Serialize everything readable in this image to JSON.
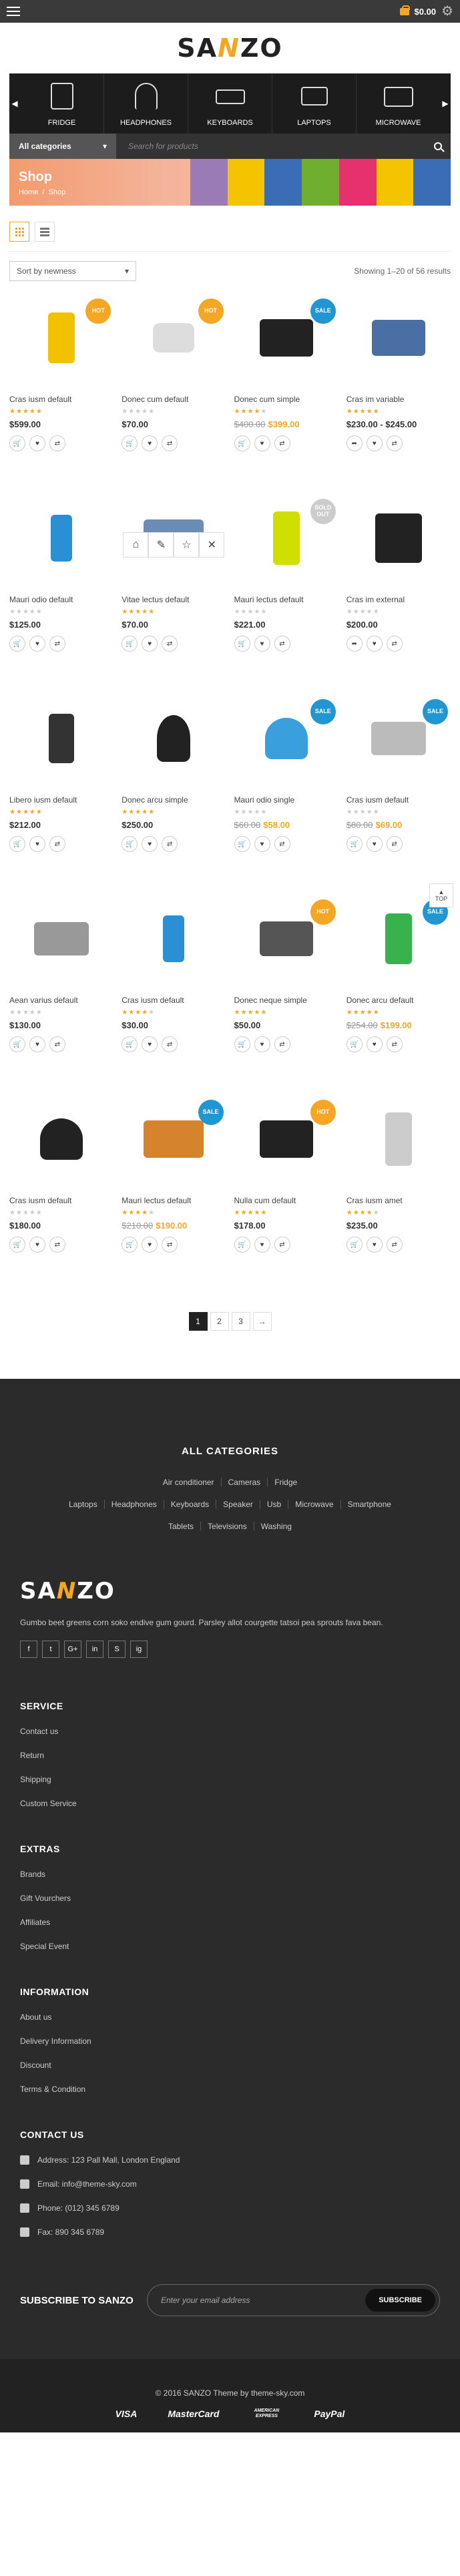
{
  "topbar": {
    "cart_total": "$0.00"
  },
  "logo": {
    "left": "SA",
    "mid": "N",
    "right": "ZO"
  },
  "categories_slider": [
    {
      "label": "FRIDGE",
      "icon": "fridge-icon"
    },
    {
      "label": "HEADPHONES",
      "icon": "headphones-icon"
    },
    {
      "label": "KEYBOARDS",
      "icon": "keyboard-icon"
    },
    {
      "label": "LAPTOPS",
      "icon": "laptop-icon"
    },
    {
      "label": "MICROWAVE",
      "icon": "microwave-icon"
    }
  ],
  "search": {
    "category": "All categories",
    "placeholder": "Search for products"
  },
  "banner": {
    "title": "Shop",
    "crumb_home": "Home",
    "crumb_sep": "/",
    "crumb_current": "Shop",
    "stripes": [
      "#9a7bb5",
      "#f5c400",
      "#3a6db5",
      "#6fae2e",
      "#e6316e",
      "#f5c400",
      "#3a6db5"
    ]
  },
  "toolbar": {
    "sort": "Sort by newness",
    "result_count": "Showing 1–20 of 56 results"
  },
  "colors": {
    "accent": "#f5a623",
    "sale": "#2196d3",
    "dark": "#2b2b2b"
  },
  "products": [
    {
      "name": "Cras iusm default",
      "rating": 5,
      "price": "$599.00",
      "old": "",
      "badge": "HOT",
      "badge_type": "hot",
      "img": "phone",
      "color": "#f2c200",
      "share": false
    },
    {
      "name": "Donec cum default",
      "rating": 0,
      "price": "$70.00",
      "old": "",
      "badge": "HOT",
      "badge_type": "hot",
      "img": "camera",
      "color": "#ddd",
      "share": false
    },
    {
      "name": "Donec cum simple",
      "rating": 4,
      "price": "$399.00",
      "old": "$400.00",
      "badge": "SALE",
      "badge_type": "sale",
      "img": "speakers",
      "color": "#222",
      "share": false
    },
    {
      "name": "Cras im variable",
      "rating": 5,
      "price": "$230.00 - $245.00",
      "old": "",
      "badge": "",
      "badge_type": "",
      "img": "laptop",
      "color": "#4a6fa5",
      "share": true
    },
    {
      "name": "Mauri odio default",
      "rating": 0,
      "price": "$125.00",
      "old": "",
      "badge": "",
      "badge_type": "",
      "img": "ipod",
      "color": "#2b8fd6",
      "share": false
    },
    {
      "name": "Vitae lectus default",
      "rating": 5,
      "price": "$70.00",
      "old": "",
      "badge": "",
      "badge_type": "",
      "img": "tv",
      "color": "#6b8cb5",
      "share": false,
      "hover": true
    },
    {
      "name": "Mauri lectus default",
      "rating": 0,
      "price": "$221.00",
      "old": "",
      "badge": "SOLD OUT",
      "badge_type": "sold",
      "img": "blender",
      "color": "#cfe000",
      "share": false
    },
    {
      "name": "Cras im external",
      "rating": 0,
      "price": "$200.00",
      "old": "",
      "badge": "",
      "badge_type": "",
      "img": "desktop",
      "color": "#222",
      "share": true
    },
    {
      "name": "Libero iusm default",
      "rating": 5,
      "price": "$212.00",
      "old": "",
      "badge": "",
      "badge_type": "",
      "img": "phone2",
      "color": "#333",
      "share": false
    },
    {
      "name": "Donec arcu simple",
      "rating": 5,
      "price": "$250.00",
      "old": "",
      "badge": "",
      "badge_type": "",
      "img": "fan",
      "color": "#222",
      "share": false
    },
    {
      "name": "Mauri odio single",
      "rating": 0,
      "price": "$58.00",
      "old": "$60.00",
      "badge": "SALE",
      "badge_type": "sale",
      "img": "headphones",
      "color": "#3aa0dd",
      "share": false
    },
    {
      "name": "Cras iusm default",
      "rating": 0,
      "price": "$69.00",
      "old": "$80.00",
      "badge": "SALE",
      "badge_type": "sale",
      "img": "macbook",
      "color": "#bbb",
      "share": false
    },
    {
      "name": "Aean varius default",
      "rating": 0,
      "price": "$130.00",
      "old": "",
      "badge": "",
      "badge_type": "",
      "img": "microwave",
      "color": "#999",
      "share": false
    },
    {
      "name": "Cras iusm default",
      "rating": 4,
      "price": "$30.00",
      "old": "",
      "badge": "",
      "badge_type": "",
      "img": "ipod",
      "color": "#2b8fd6",
      "share": false
    },
    {
      "name": "Donec neque simple",
      "rating": 5,
      "price": "$50.00",
      "old": "",
      "badge": "HOT",
      "badge_type": "hot",
      "img": "tablet",
      "color": "#555",
      "share": false
    },
    {
      "name": "Donec arcu default",
      "rating": 5,
      "price": "$199.00",
      "old": "$254.00",
      "badge": "SALE",
      "badge_type": "sale",
      "img": "iphone",
      "color": "#37b24d",
      "share": false
    },
    {
      "name": "Cras iusm default",
      "rating": 0,
      "price": "$180.00",
      "old": "",
      "badge": "",
      "badge_type": "",
      "img": "headphones",
      "color": "#222",
      "share": false
    },
    {
      "name": "Mauri lectus default",
      "rating": 4,
      "price": "$190.00",
      "old": "$210.00",
      "badge": "SALE",
      "badge_type": "sale",
      "img": "tv",
      "color": "#d5832c",
      "share": false
    },
    {
      "name": "Nulla cum default",
      "rating": 5,
      "price": "$178.00",
      "old": "",
      "badge": "HOT",
      "badge_type": "hot",
      "img": "speakers",
      "color": "#222",
      "share": false
    },
    {
      "name": "Cras iusm amet",
      "rating": 4,
      "price": "$235.00",
      "old": "",
      "badge": "",
      "badge_type": "",
      "img": "cooler",
      "color": "#ccc",
      "share": false
    }
  ],
  "top_button": "TOP",
  "pagination": [
    "1",
    "2",
    "3",
    "→"
  ],
  "footer": {
    "all_categories_title": "ALL CATEGORIES",
    "category_rows": [
      [
        "Air conditioner",
        "Cameras",
        "Fridge"
      ],
      [
        "Laptops",
        "Headphones",
        "Keyboards",
        "Speaker",
        "Usb",
        "Microwave",
        "Smartphone"
      ],
      [
        "Tablets",
        "Televisions",
        "Washing"
      ]
    ],
    "description": "Gumbo beet greens corn soko endive gum gourd. Parsley allot courgette tatsoi pea sprouts fava bean.",
    "social": [
      "f",
      "t",
      "G+",
      "in",
      "S",
      "ig"
    ],
    "service": {
      "title": "SERVICE",
      "items": [
        "Contact us",
        "Return",
        "Shipping",
        "Custom Service"
      ]
    },
    "extras": {
      "title": "EXTRAS",
      "items": [
        "Brands",
        "Gift Vourchers",
        "Affiliates",
        "Special Event"
      ]
    },
    "information": {
      "title": "INFORMATION",
      "items": [
        "About us",
        "Delivery Information",
        "Discount",
        "Terms & Condition"
      ]
    },
    "contact": {
      "title": "CONTACT US",
      "address": "Address: 123 Pall Mall, London England",
      "email": "Email: info@theme-sky.com",
      "phone": "Phone: (012) 345 6789",
      "fax": "Fax: 890 345 6789"
    },
    "subscribe": {
      "title": "SUBSCRIBE TO SANZO",
      "placeholder": "Enter your email address",
      "button": "SUBSCRIBE"
    },
    "copyright": "© 2016 SANZO Theme by theme-sky.com",
    "payments": [
      "VISA",
      "MasterCard",
      "AMERICAN EXPRESS",
      "PayPal"
    ]
  }
}
